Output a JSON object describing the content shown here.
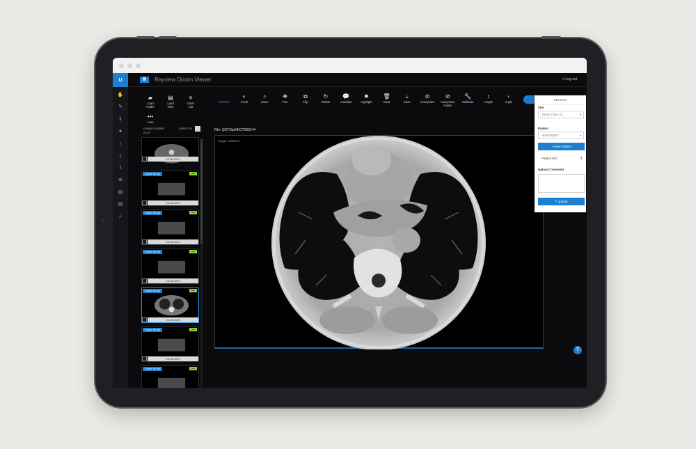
{
  "app": {
    "logo": "U",
    "title": "Rayview Dicom Viewer",
    "logout": "Log out",
    "menu_icon": "grid-icon"
  },
  "rail_icons": [
    "hand-icon",
    "pencil-icon",
    "info-icon",
    "user-group-icon",
    "bell-icon",
    "download-icon",
    "import-icon",
    "database-icon",
    "book-icon",
    "book-icon",
    "search-icon"
  ],
  "load_tools": [
    {
      "name": "load-folder",
      "label": "Load\nFolder",
      "icon": "folder-icon"
    },
    {
      "name": "load-files",
      "label": "Load\nFiles",
      "icon": "file-icon"
    },
    {
      "name": "clear-list",
      "label": "Clear\nList",
      "icon": "clear-list-icon"
    }
  ],
  "less_label": "Less",
  "toolbar": [
    {
      "name": "ww-wc",
      "label": "WW/WC",
      "icon": "contrast-ring-icon",
      "active": true
    },
    {
      "name": "invert",
      "label": "Invert",
      "icon": "half-circle-icon"
    },
    {
      "name": "zoom",
      "label": "Zoom",
      "icon": "search-icon"
    },
    {
      "name": "pan",
      "label": "Pan",
      "icon": "move-icon"
    },
    {
      "name": "flip",
      "label": "Flip",
      "icon": "flip-icon"
    },
    {
      "name": "rotate",
      "label": "Rotate",
      "icon": "rotate-icon"
    },
    {
      "name": "annotate",
      "label": "Annotate",
      "icon": "speech-bubble-icon"
    },
    {
      "name": "highlight",
      "label": "Highlight",
      "icon": "sun-icon"
    },
    {
      "name": "clear",
      "label": "Clear",
      "icon": "trash-icon"
    },
    {
      "name": "save",
      "label": "Save",
      "icon": "save-icon"
    },
    {
      "name": "anonymize",
      "label": "Anonymize",
      "icon": "eye-slash-icon"
    },
    {
      "name": "anonymize-folder",
      "label": "Anonymize\nFolder",
      "icon": "eye-slash-icon"
    },
    {
      "name": "calibrate",
      "label": "Calibrate",
      "icon": "wrench-icon"
    },
    {
      "name": "length",
      "label": "Length",
      "icon": "ruler-icon"
    },
    {
      "name": "angle",
      "label": "Angle",
      "icon": "angle-icon"
    }
  ],
  "thumbs": {
    "images_loaded_label": "Images loaded:",
    "images_loaded_count": "2110",
    "select_all": "Select All",
    "items": [
      {
        "tag": "",
        "date": "20.08.2019",
        "new_badge": "",
        "selected": false
      },
      {
        "tag": "Same Study",
        "date": "20.08.2019",
        "new_badge": "new",
        "selected": false
      },
      {
        "tag": "Same Study",
        "date": "20.08.2019",
        "new_badge": "new",
        "selected": false
      },
      {
        "tag": "Same Study",
        "date": "20.08.2019",
        "new_badge": "new",
        "selected": false
      },
      {
        "tag": "Same Study",
        "date": "20.08.2019",
        "new_badge": "new",
        "selected": true
      },
      {
        "tag": "Same Study",
        "date": "20.08.2019",
        "new_badge": "new",
        "selected": false
      },
      {
        "tag": "Same Study",
        "date": "",
        "new_badge": "new",
        "selected": false
      }
    ]
  },
  "viewer": {
    "file": "File: QCT/Se04/CT000144",
    "image": "Image: 145/614"
  },
  "upload": {
    "tab_icon": "user-icon",
    "title": "UPLOAD",
    "site_label": "Site",
    "site_value": "Demo Clinic 01",
    "patient_label": "Patient",
    "patient_value": "0040745507",
    "new_patient": "+ New Patient",
    "patient_info": "Patient Info",
    "info_icon": "info-circle-icon",
    "comment_label": "Upload Comment",
    "upload_button": "Upload"
  },
  "help_icon": "question-icon",
  "colors": {
    "accent": "#1c7fd0",
    "new_badge": "#8bd13a",
    "frame": "#1f2024",
    "background": "#ebeae6"
  }
}
